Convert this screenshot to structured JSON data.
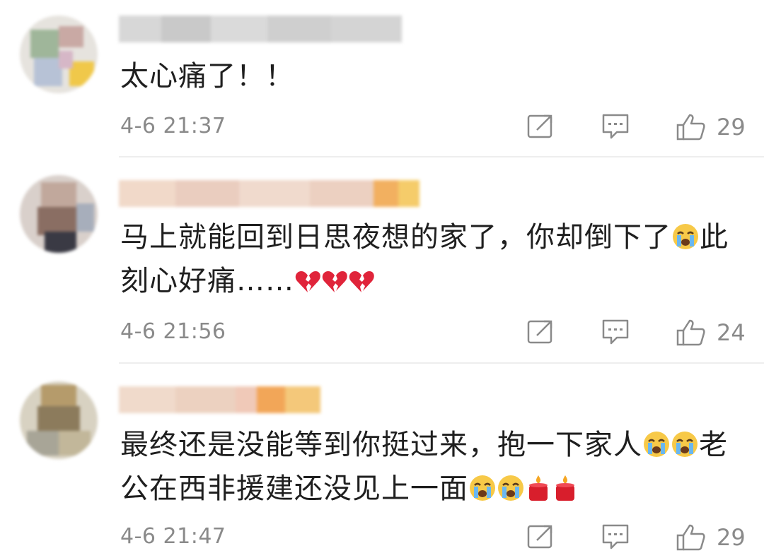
{
  "comments": [
    {
      "text": "太心痛了！！",
      "time": "4-6 21:37",
      "likes": "29",
      "emoji_after": []
    },
    {
      "text_line1": "马上就能回到日思夜想的家了，你却倒下了",
      "text_line1_end": "此",
      "text_line2": "刻心好痛……",
      "time": "4-6 21:56",
      "likes": "24",
      "emoji_inline": [
        "crying-face"
      ],
      "emoji_after": [
        "broken-heart",
        "broken-heart",
        "broken-heart"
      ]
    },
    {
      "text_line1": "最终还是没能等到你挺过来，抱一下家人",
      "text_line1_end": "老",
      "text_line2": "公在西非援建还没见上一面",
      "time": "4-6 21:47",
      "likes": "29",
      "emoji_inline": [
        "crying-face",
        "crying-face"
      ],
      "emoji_after": [
        "crying-face",
        "crying-face",
        "candle",
        "candle"
      ]
    }
  ],
  "icons": {
    "share": "share-icon",
    "reply": "comment-icon",
    "like": "thumbs-up-icon"
  },
  "colors": {
    "meta_text": "#8a8a8a",
    "divider": "#eeeeee",
    "icon": "#8a8a8a"
  }
}
